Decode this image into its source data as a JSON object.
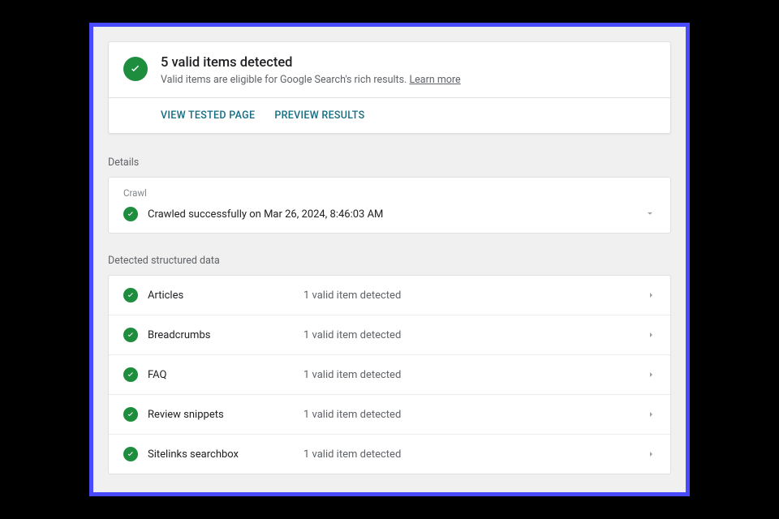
{
  "summary": {
    "title": "5 valid items detected",
    "subtitle_prefix": "Valid items are eligible for Google Search's rich results. ",
    "learn_more": "Learn more"
  },
  "actions": {
    "view_tested": "VIEW TESTED PAGE",
    "preview": "PREVIEW RESULTS"
  },
  "sections": {
    "details": "Details",
    "crawl_label": "Crawl",
    "crawl_text": "Crawled successfully on Mar 26, 2024, 8:46:03 AM",
    "detected": "Detected structured data"
  },
  "items": [
    {
      "name": "Articles",
      "status": "1 valid item detected"
    },
    {
      "name": "Breadcrumbs",
      "status": "1 valid item detected"
    },
    {
      "name": "FAQ",
      "status": "1 valid item detected"
    },
    {
      "name": "Review snippets",
      "status": "1 valid item detected"
    },
    {
      "name": "Sitelinks searchbox",
      "status": "1 valid item detected"
    }
  ]
}
